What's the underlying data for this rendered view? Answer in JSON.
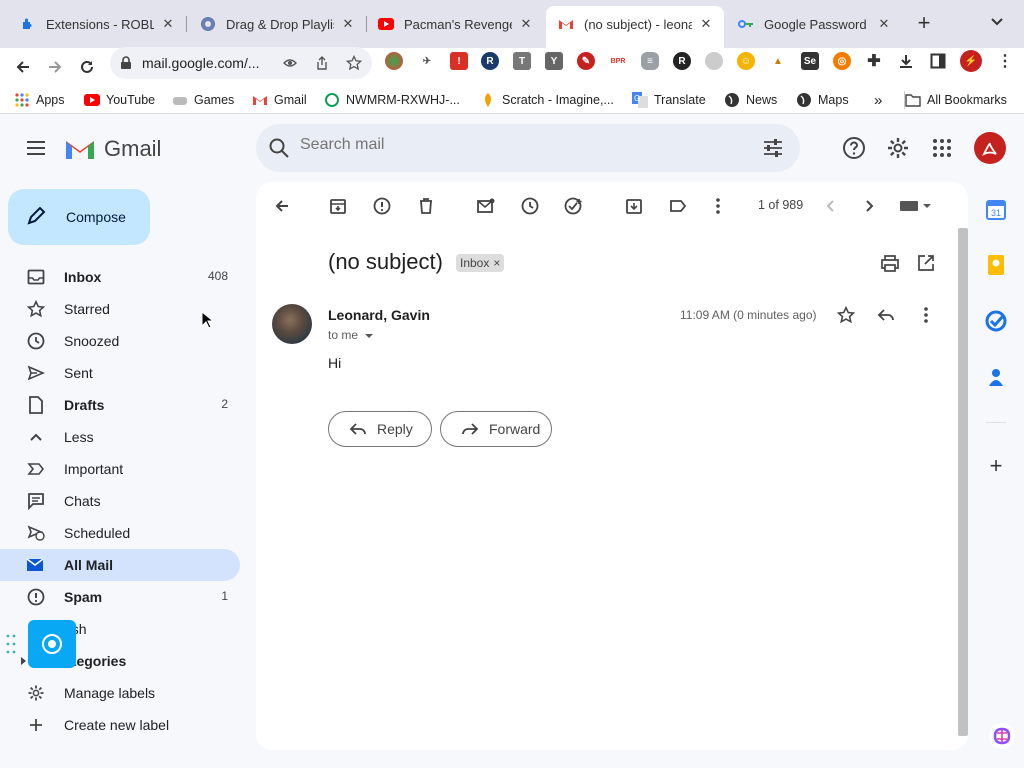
{
  "browser": {
    "tabs": [
      {
        "title": "Extensions - ROBLOX",
        "icon": "puzzle-icon"
      },
      {
        "title": "Drag & Drop Playlist",
        "icon": "disc-icon"
      },
      {
        "title": "Pacman's Revenge",
        "icon": "youtube-icon"
      },
      {
        "title": "(no subject) - leonard",
        "icon": "gmail-icon"
      },
      {
        "title": "Google Password M",
        "icon": "key-icon"
      }
    ],
    "url": "mail.google.com/...",
    "bookmarks": [
      {
        "label": "Apps",
        "icon": "apps-grid-icon"
      },
      {
        "label": "YouTube",
        "icon": "youtube-icon"
      },
      {
        "label": "Games",
        "icon": "games-icon"
      },
      {
        "label": "Gmail",
        "icon": "gmail-icon"
      },
      {
        "label": "NWMRM-RXWHJ-...",
        "icon": "phone-icon"
      },
      {
        "label": "Scratch - Imagine,...",
        "icon": "scratch-icon"
      },
      {
        "label": "Translate",
        "icon": "translate-icon"
      },
      {
        "label": "News",
        "icon": "globe-icon"
      },
      {
        "label": "Maps",
        "icon": "globe-icon"
      }
    ],
    "bookmarks_overflow": "»",
    "all_bookmarks": "All Bookmarks"
  },
  "gmail": {
    "logo_text": "Gmail",
    "search_placeholder": "Search mail",
    "compose": "Compose",
    "nav": [
      {
        "label": "Inbox",
        "count": "408",
        "icon": "inbox-icon"
      },
      {
        "label": "Starred",
        "count": "",
        "icon": "star-icon"
      },
      {
        "label": "Snoozed",
        "count": "",
        "icon": "clock-icon"
      },
      {
        "label": "Sent",
        "count": "",
        "icon": "send-icon"
      },
      {
        "label": "Drafts",
        "count": "2",
        "icon": "draft-icon"
      },
      {
        "label": "Less",
        "count": "",
        "icon": "chevron-up-icon"
      },
      {
        "label": "Important",
        "count": "",
        "icon": "important-icon"
      },
      {
        "label": "Chats",
        "count": "",
        "icon": "chat-icon"
      },
      {
        "label": "Scheduled",
        "count": "",
        "icon": "scheduled-icon"
      },
      {
        "label": "All Mail",
        "count": "",
        "icon": "all-mail-icon"
      },
      {
        "label": "Spam",
        "count": "1",
        "icon": "spam-icon"
      },
      {
        "label": "ash",
        "count": "",
        "icon": "trash-icon"
      },
      {
        "label": "ategories",
        "count": "",
        "icon": "label-icon"
      },
      {
        "label": "Manage labels",
        "count": "",
        "icon": "gear-icon"
      },
      {
        "label": "Create new label",
        "count": "",
        "icon": "plus-icon"
      }
    ],
    "pager": "1 of 989",
    "message": {
      "subject": "(no subject)",
      "label_chip": "Inbox",
      "sender": "Leonard, Gavin",
      "to": "to me",
      "time": "11:09 AM (0 minutes ago)",
      "body": "Hi",
      "reply": "Reply",
      "forward": "Forward"
    },
    "calendar_day": "31"
  },
  "colors": {
    "accent": "#0b57d0",
    "compose_bg": "#c2e7ff",
    "selected_nav": "#d3e3fd",
    "page_bg": "#f6f8fc",
    "avatar": "#c5221f"
  }
}
